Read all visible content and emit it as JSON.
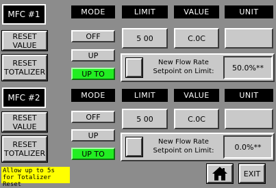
{
  "headers": {
    "mode": "MODE",
    "limit": "LIMIT",
    "value": "VALUE",
    "unit": "UNIT"
  },
  "mfc1": {
    "title": "MFC #1",
    "reset_value": "RESET VALUE",
    "reset_totalizer": "RESET TOTALIZER",
    "mode_off": "OFF",
    "mode_up": "UP",
    "mode_upto": "UP TO",
    "limit": "5 00",
    "value": "C.0C",
    "unit": "",
    "flow_text": "New Flow Rate Setpoint on Limit:",
    "setpoint": "50.0%**"
  },
  "mfc2": {
    "title": "MFC #2",
    "reset_value": "RESET VALUE",
    "reset_totalizer": "RESET TOTALIZER",
    "mode_off": "OFF",
    "mode_up": "UP",
    "mode_upto": "UP TO",
    "limit": "5 00",
    "value": "C.0C",
    "unit": "",
    "flow_text": "New Flow Rate Setpoint on Limit:",
    "setpoint": "0.0%**"
  },
  "footer": {
    "note": "Allow up to 5s for Totalizer Reset",
    "exit": "EXIT",
    "home_icon": "home-icon"
  },
  "colors": {
    "background": "#8c8c8c",
    "active_mode": "#22ee22",
    "note_bg": "#ffff00"
  }
}
